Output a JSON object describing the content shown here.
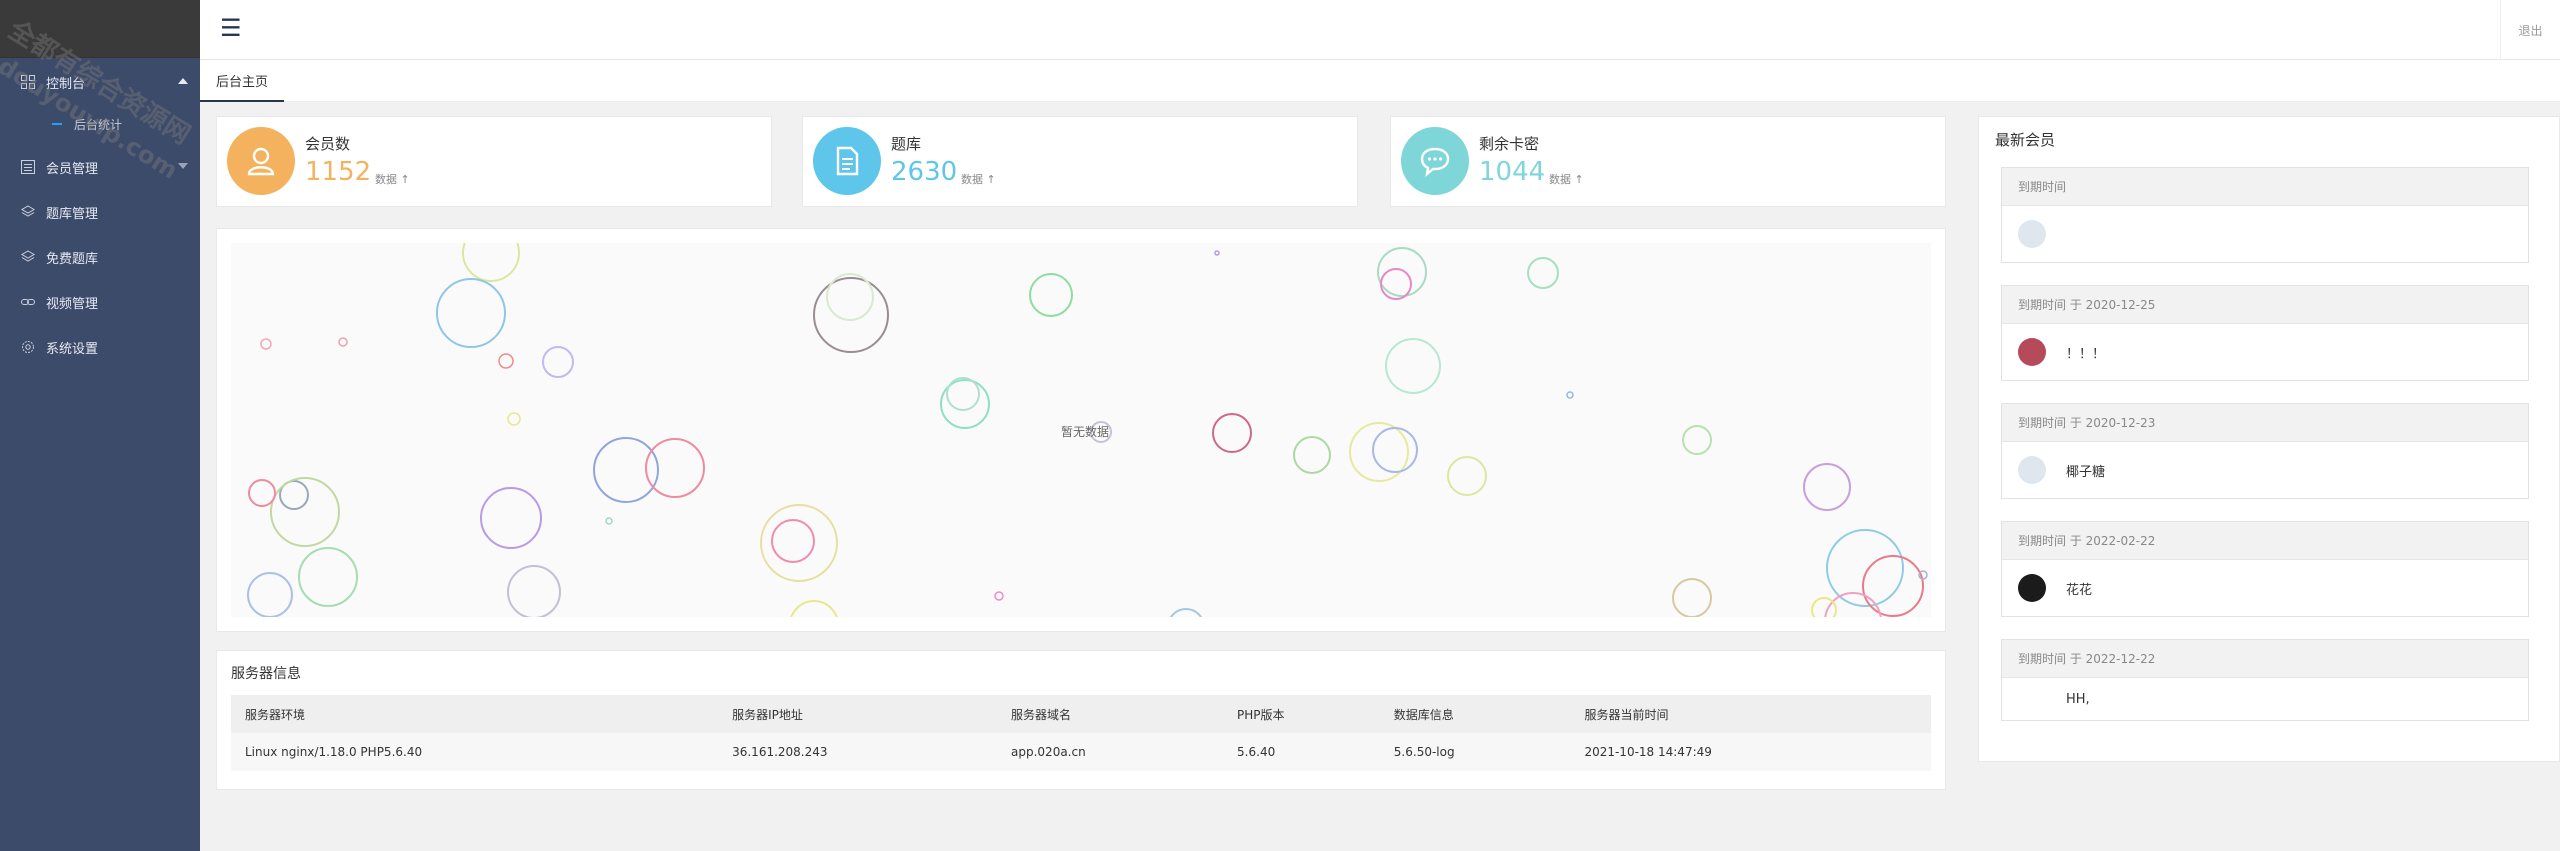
{
  "sidebar": {
    "items": [
      {
        "label": "控制台",
        "icon": "grid-icon",
        "expanded": true
      },
      {
        "label": "会员管理",
        "icon": "list-icon"
      },
      {
        "label": "题库管理",
        "icon": "layers-icon"
      },
      {
        "label": "免费题库",
        "icon": "layers-icon"
      },
      {
        "label": "视频管理",
        "icon": "link-icon"
      },
      {
        "label": "系统设置",
        "icon": "gear-icon"
      }
    ],
    "sub_items": [
      {
        "label": "后台统计"
      }
    ]
  },
  "header": {
    "menu_icon": "☰",
    "logout_label": "退出"
  },
  "tabs": [
    {
      "label": "后台主页",
      "active": true
    }
  ],
  "stats": [
    {
      "title": "会员数",
      "value": "1152",
      "note": "数据",
      "icon": "user-icon",
      "color": "#f5b25e"
    },
    {
      "title": "题库",
      "value": "2630",
      "note": "数据",
      "icon": "document-icon",
      "color": "#5ec6ea"
    },
    {
      "title": "剩余卡密",
      "value": "1044",
      "note": "数据",
      "icon": "chat-icon",
      "color": "#7fd6d8"
    }
  ],
  "chart": {
    "empty_label": "暂无数据"
  },
  "server_info": {
    "title": "服务器信息",
    "columns": [
      "服务器环境",
      "服务器IP地址",
      "服务器域名",
      "PHP版本",
      "数据库信息",
      "服务器当前时间"
    ],
    "row": [
      "Linux nginx/1.18.0 PHP5.6.40",
      "36.161.208.243",
      "app.020a.cn",
      "5.6.40",
      "5.6.50-log",
      "2021-10-18 14:47:49"
    ]
  },
  "members": {
    "title": "最新会员",
    "items": [
      {
        "expiry": "到期时间",
        "name": "",
        "avatar_color": "#dfe6ee"
      },
      {
        "expiry": "到期时间 于 2020-12-25",
        "name": "！！！",
        "avatar_color": "#b54a5a"
      },
      {
        "expiry": "到期时间 于 2020-12-23",
        "name": "椰子糖",
        "avatar_color": "#dfe6ee"
      },
      {
        "expiry": "到期时间 于 2022-02-22",
        "name": "花花",
        "avatar_color": "#1b1b1b"
      },
      {
        "expiry": "到期时间 于 2022-12-22",
        "name": "HH,",
        "avatar_color": "#ffffff"
      }
    ]
  },
  "watermark": {
    "line1": "全都有综合资源网",
    "line2": "douyouvip.com"
  }
}
